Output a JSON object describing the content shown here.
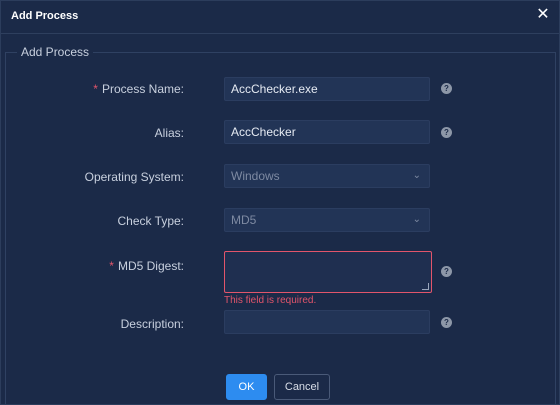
{
  "dialog": {
    "title": "Add Process",
    "close_icon": "close-icon"
  },
  "section": {
    "legend": "Add Process"
  },
  "form": {
    "process_name": {
      "label": "Process Name:",
      "required": "*",
      "value": "AccChecker.exe"
    },
    "alias": {
      "label": "Alias:",
      "value": "AccChecker"
    },
    "operating_system": {
      "label": "Operating System:",
      "value": "Windows"
    },
    "check_type": {
      "label": "Check Type:",
      "value": "MD5"
    },
    "md5_digest": {
      "label": "MD5 Digest:",
      "required": "*",
      "value": "",
      "error": "This field is required."
    },
    "description": {
      "label": "Description:",
      "value": ""
    },
    "help_glyph": "?"
  },
  "buttons": {
    "ok": "OK",
    "cancel": "Cancel"
  },
  "colors": {
    "background": "#1b2a48",
    "input": "#223456",
    "primary": "#2d8cf0",
    "error": "#e2556b"
  }
}
